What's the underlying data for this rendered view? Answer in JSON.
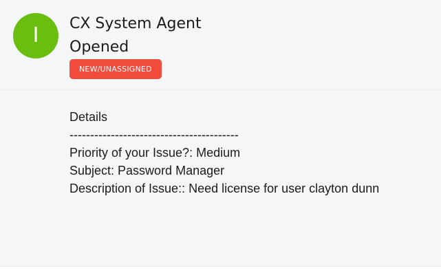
{
  "header": {
    "avatar_initial": "I",
    "avatar_color": "#6abe0f",
    "agent_name": "CX System Agent",
    "action": "Opened",
    "status_badge": "NEW/UNASSIGNED",
    "status_color": "#f04b3c"
  },
  "details": {
    "title": "Details",
    "separator": "-----------------------------------------",
    "lines": [
      "Priority of your Issue?: Medium",
      "Subject: Password Manager",
      "Description of Issue:: Need license for user clayton dunn"
    ]
  }
}
